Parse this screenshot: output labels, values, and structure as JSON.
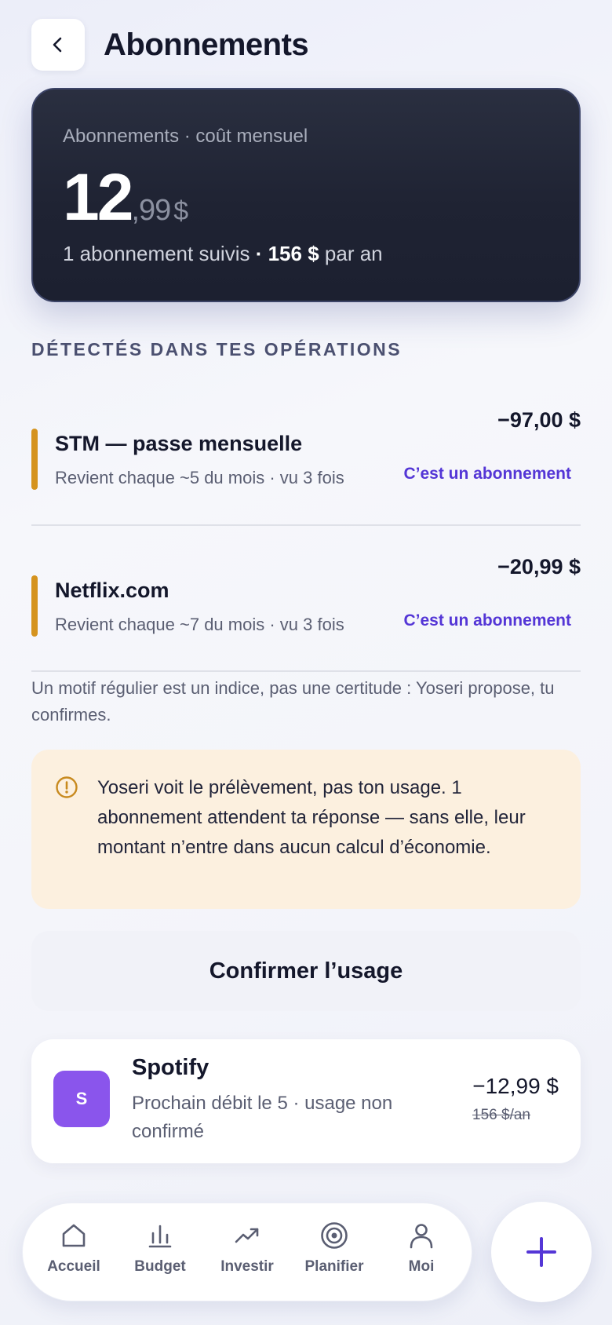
{
  "header": {
    "title": "Abonnements",
    "back_icon": "chevron-left-icon"
  },
  "summary": {
    "label": "Abonnements · coût mensuel",
    "amount_int": "12",
    "amount_dec": ",99",
    "currency": "$",
    "count_text": "1 abonnement suivis",
    "sep": " · ",
    "yearly_amount": "156 $",
    "yearly_suffix": " par an"
  },
  "detected": {
    "title": "DÉTECTÉS DANS TES OPÉRATIONS",
    "accent_color": "#d5931e",
    "items": [
      {
        "name": "STM — passe mensuelle",
        "subtitle": "Revient chaque ~5 du mois · vu 3 fois",
        "amount": "−97,00 $",
        "action": "C’est un abonnement"
      },
      {
        "name": "Netflix.com",
        "subtitle": "Revient chaque ~7 du mois · vu 3 fois",
        "amount": "−20,99 $",
        "action": "C’est un abonnement"
      }
    ]
  },
  "note": "Un motif régulier est un indice, pas une certitude : Yoseri propose, tu confirmes.",
  "warning": {
    "icon": "alert-circle-icon",
    "text": "Yoseri voit le prélèvement, pas ton usage. 1 abonnement attendent ta réponse — sans elle, leur montant n’entre dans aucun calcul d’économie."
  },
  "confirm_button": "Confirmer l’usage",
  "subscription": {
    "avatar_letter": "S",
    "avatar_color": "#8a55ec",
    "name": "Spotify",
    "description": "Prochain débit le 5 · usage non confirmé",
    "amount": "−12,99 $",
    "yearly": "156 $/an"
  },
  "nav": {
    "items": [
      {
        "label": "Accueil",
        "icon": "home-icon"
      },
      {
        "label": "Budget",
        "icon": "bar-chart-icon"
      },
      {
        "label": "Investir",
        "icon": "trending-up-icon"
      },
      {
        "label": "Planifier",
        "icon": "target-icon"
      },
      {
        "label": "Moi",
        "icon": "user-icon"
      }
    ],
    "fab_icon": "plus-icon",
    "accent_color": "#5436d6"
  }
}
